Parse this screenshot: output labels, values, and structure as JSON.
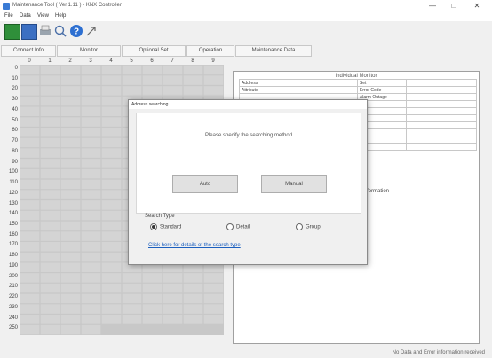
{
  "window": {
    "title": "Maintenance Tool ( Ver.1.11 ) - KNX Controller",
    "controls": [
      "—",
      "□",
      "✕"
    ]
  },
  "menu": [
    "File",
    "Data",
    "View",
    "Help"
  ],
  "toolbar": {
    "icons": [
      "new-icon",
      "save-icon",
      "print-icon",
      "search-icon",
      "help-icon",
      "arrow-icon"
    ]
  },
  "tabs": [
    "Connect Info",
    "Monitor",
    "Optional Set",
    "Operation",
    "Maintenance Data"
  ],
  "grid": {
    "columns": [
      "0",
      "1",
      "2",
      "3",
      "4",
      "5",
      "6",
      "7",
      "8",
      "9"
    ],
    "rows": [
      "0",
      "10",
      "20",
      "30",
      "40",
      "50",
      "60",
      "70",
      "80",
      "90",
      "100",
      "110",
      "120",
      "130",
      "140",
      "150",
      "160",
      "170",
      "180",
      "190",
      "200",
      "210",
      "220",
      "230",
      "240",
      "250"
    ]
  },
  "monitor": {
    "title": "Individual Monitor",
    "rows": [
      [
        "Address",
        "",
        "Set",
        ""
      ],
      [
        "Attribute",
        "",
        "Error Code",
        ""
      ],
      [
        "",
        "",
        "Alarm Outage",
        ""
      ],
      [
        "",
        "",
        "",
        ""
      ],
      [
        "",
        "",
        "",
        ""
      ],
      [
        "",
        "",
        "",
        ""
      ],
      [
        "",
        "",
        "",
        ""
      ],
      [
        "",
        "",
        "",
        ""
      ],
      [
        "",
        "",
        "",
        ""
      ],
      [
        "",
        "",
        "",
        ""
      ]
    ],
    "sub_label": "Information"
  },
  "status": {
    "text": "No Data and Error information received"
  },
  "dialog": {
    "title": "Address searching",
    "prompt": "Please specify the searching method",
    "auto_label": "Auto",
    "manual_label": "Manual",
    "search_type_label": "Search Type",
    "options": [
      {
        "label": "Standard",
        "selected": true
      },
      {
        "label": "Detail",
        "selected": false
      },
      {
        "label": "Group",
        "selected": false
      }
    ],
    "link": "Click here for details of the search type"
  }
}
